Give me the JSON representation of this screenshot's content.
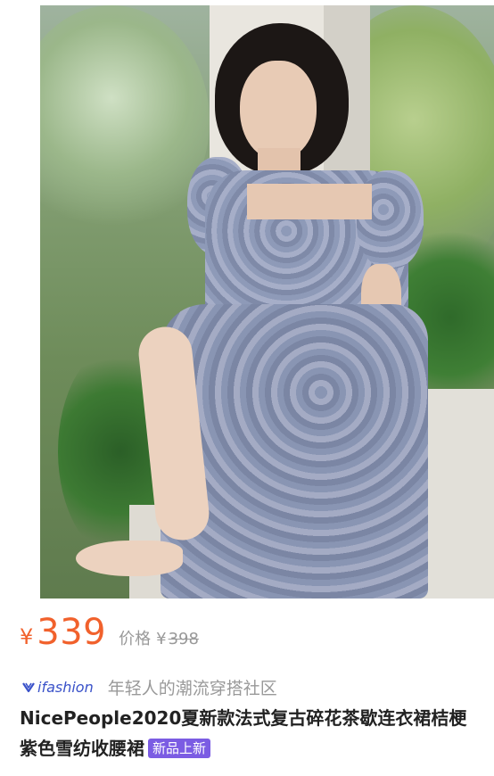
{
  "price": {
    "currency": "¥",
    "value": "339",
    "original_label": "价格",
    "original_currency": "¥",
    "original_value": "398"
  },
  "brand": {
    "name": "ifashion",
    "tagline": "年轻人的潮流穿搭社区",
    "icon": "ifashion-logo-icon",
    "color": "#3a52c9"
  },
  "product": {
    "title": "NicePeople2020夏新款法式复古碎花茶歇连衣裙桔梗紫色雪纺收腰裙",
    "badge": "新品上新",
    "badge_color": "#7b5ce3"
  },
  "colors": {
    "price": "#f1612c",
    "muted": "#999999",
    "title": "#222222"
  }
}
